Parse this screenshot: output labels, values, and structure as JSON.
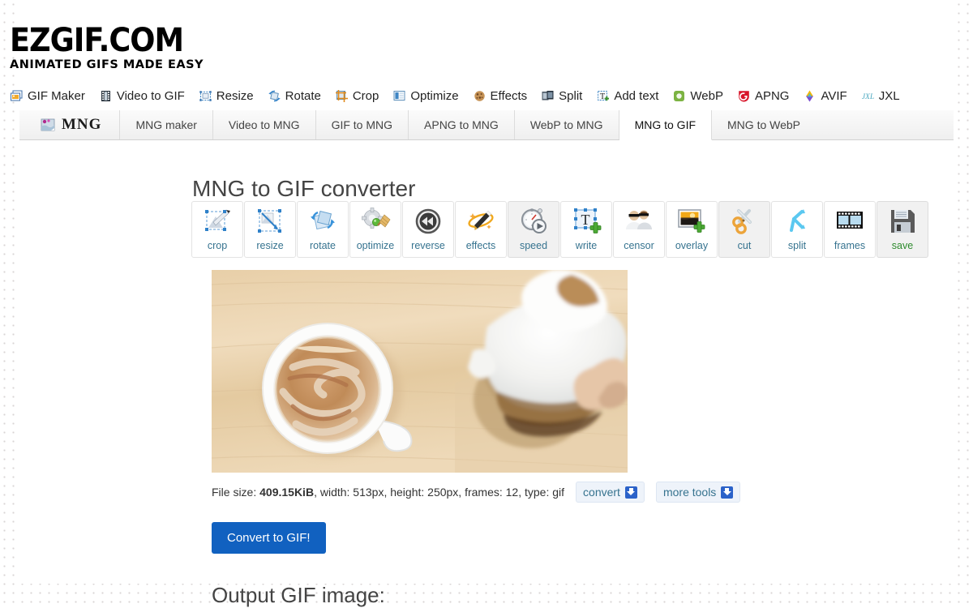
{
  "site": {
    "logo_main": "EZGIF.COM",
    "logo_sub": "ANIMATED GIFS MADE EASY"
  },
  "main_nav": [
    {
      "label": "GIF Maker",
      "icon": "gif-maker-icon"
    },
    {
      "label": "Video to GIF",
      "icon": "film-strip-icon"
    },
    {
      "label": "Resize",
      "icon": "resize-icon"
    },
    {
      "label": "Rotate",
      "icon": "rotate-icon"
    },
    {
      "label": "Crop",
      "icon": "crop-icon"
    },
    {
      "label": "Optimize",
      "icon": "optimize-icon"
    },
    {
      "label": "Effects",
      "icon": "effects-icon"
    },
    {
      "label": "Split",
      "icon": "split-icon"
    },
    {
      "label": "Add text",
      "icon": "add-text-icon"
    },
    {
      "label": "WebP",
      "icon": "webp-icon"
    },
    {
      "label": "APNG",
      "icon": "apng-icon"
    },
    {
      "label": "AVIF",
      "icon": "avif-icon"
    },
    {
      "label": "JXL",
      "icon": "jxl-icon"
    }
  ],
  "sub_nav": {
    "logo_tab": {
      "label": "MNG",
      "icon": "mng-logo-icon"
    },
    "tabs": [
      {
        "label": "MNG maker",
        "active": false
      },
      {
        "label": "Video to MNG",
        "active": false
      },
      {
        "label": "GIF to MNG",
        "active": false
      },
      {
        "label": "APNG to MNG",
        "active": false
      },
      {
        "label": "WebP to MNG",
        "active": false
      },
      {
        "label": "MNG to GIF",
        "active": true
      },
      {
        "label": "MNG to WebP",
        "active": false
      }
    ]
  },
  "page": {
    "title": "MNG to GIF converter",
    "output_title": "Output GIF image:"
  },
  "tools": [
    {
      "label": "crop",
      "icon": "crop-tool-icon",
      "highlight": false,
      "color": "blue"
    },
    {
      "label": "resize",
      "icon": "resize-tool-icon",
      "highlight": false,
      "color": "blue"
    },
    {
      "label": "rotate",
      "icon": "rotate-tool-icon",
      "highlight": false,
      "color": "blue"
    },
    {
      "label": "optimize",
      "icon": "optimize-tool-icon",
      "highlight": false,
      "color": "blue"
    },
    {
      "label": "reverse",
      "icon": "reverse-tool-icon",
      "highlight": false,
      "color": "blue"
    },
    {
      "label": "effects",
      "icon": "effects-tool-icon",
      "highlight": false,
      "color": "blue"
    },
    {
      "label": "speed",
      "icon": "speed-tool-icon",
      "highlight": true,
      "color": "blue"
    },
    {
      "label": "write",
      "icon": "write-tool-icon",
      "highlight": false,
      "color": "blue"
    },
    {
      "label": "censor",
      "icon": "censor-tool-icon",
      "highlight": false,
      "color": "blue"
    },
    {
      "label": "overlay",
      "icon": "overlay-tool-icon",
      "highlight": false,
      "color": "blue"
    },
    {
      "label": "cut",
      "icon": "cut-tool-icon",
      "highlight": true,
      "color": "blue"
    },
    {
      "label": "split",
      "icon": "split-tool-icon",
      "highlight": false,
      "color": "blue"
    },
    {
      "label": "frames",
      "icon": "frames-tool-icon",
      "highlight": false,
      "color": "blue"
    },
    {
      "label": "save",
      "icon": "save-tool-icon",
      "highlight": true,
      "color": "green"
    }
  ],
  "preview": {
    "alt": "coffee cup with latte art and milk pitcher on wooden table"
  },
  "file_info": {
    "prefix": "File size: ",
    "size": "409.15KiB",
    "rest": ", width: 513px, height: 250px, frames: 12, type: gif",
    "convert_label": "convert",
    "more_tools_label": "more tools"
  },
  "actions": {
    "convert_button": "Convert to GIF!"
  },
  "colors": {
    "accent_blue": "#1161c0",
    "link_blue": "#36738f",
    "save_green": "#2e8b2e",
    "page_bg": "#ffffff"
  }
}
